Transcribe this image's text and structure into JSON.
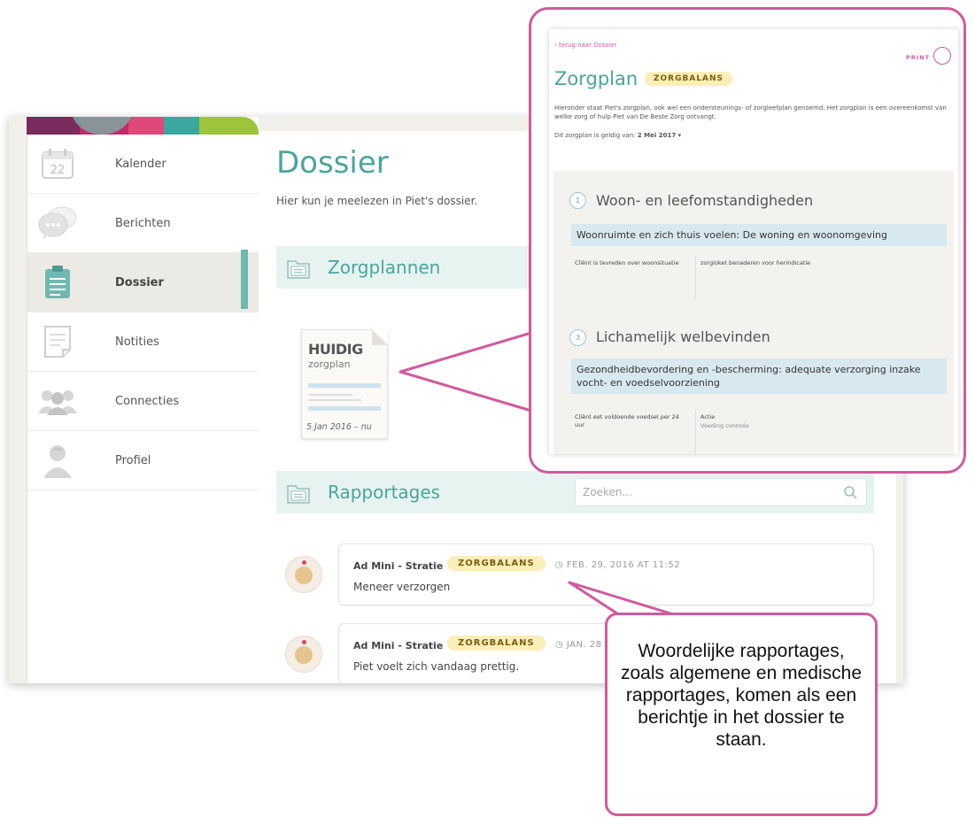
{
  "sidebar": {
    "items": [
      {
        "label": "Kalender",
        "icon": "calendar-icon",
        "icon_text": "22"
      },
      {
        "label": "Berichten",
        "icon": "chat-bubbles-icon"
      },
      {
        "label": "Dossier",
        "icon": "clipboard-icon",
        "active": true
      },
      {
        "label": "Notities",
        "icon": "notes-icon"
      },
      {
        "label": "Connecties",
        "icon": "people-icon"
      },
      {
        "label": "Profiel",
        "icon": "person-icon"
      }
    ]
  },
  "main": {
    "title": "Dossier",
    "subtitle": "Hier kun je meelezen in Piet's dossier.",
    "zorgplannen": {
      "title": "Zorgplannen",
      "doc_heading": "HUIDIG",
      "doc_sub": "zorgplan",
      "doc_date": "5 Jan 2016 – nu"
    },
    "rapportages": {
      "title": "Rapportages",
      "search_placeholder": "Zoeken...",
      "posts": [
        {
          "author": "Ad Mini - Stratie",
          "badge": "ZORGBALANS",
          "time": "FEB. 29, 2016 AT 11:52",
          "message": "Meneer verzorgen"
        },
        {
          "author": "Ad Mini - Stratie",
          "badge": "ZORGBALANS",
          "time": "JAN. 28",
          "message": "Piet voelt zich vandaag prettig."
        }
      ]
    }
  },
  "zoom": {
    "back_link": "‹ terug naar Dossier",
    "print_label": "PRINT",
    "title": "Zorgplan",
    "badge": "ZORGBALANS",
    "description": "Hieronder staat Piet's zorgplan, ook wel een ondersteunings- of zorgleefplan genoemd. Het zorgplan is een overeenkomst van welke zorg of hulp Piet van De Beste Zorg ontvangt.",
    "valid_label": "Dit zorgplan is geldig van:",
    "valid_date": "2 Mei 2017 ▾",
    "sections": [
      {
        "number": "1",
        "title": "Woon- en leefomstandigheden",
        "bar": "Woonruimte en zich thuis voelen: De woning en woonomgeving",
        "left": "Cliënt is tevreden over woonsituatie",
        "right": "zorgloket benaderen voor herindicatie"
      },
      {
        "number": "3",
        "title": "Lichamelijk welbevinden",
        "bar": "Gezondheidbevordering en -bescherming: adequate verzorging inzake vocht- en voedselvoorziening",
        "left": "Cliënt eet voldoende voedsel per 24 uur",
        "right_title": "Actie",
        "right": "Voeding controle"
      }
    ]
  },
  "annotation": {
    "text": "Woordelijke rapportages, zoals algemene en medische rapportages, komen als een berichtje in het dossier te staan."
  },
  "colors": {
    "accent": "#4aa59d",
    "callout": "#d15a9b",
    "badge_bg": "#fbeeb7"
  }
}
